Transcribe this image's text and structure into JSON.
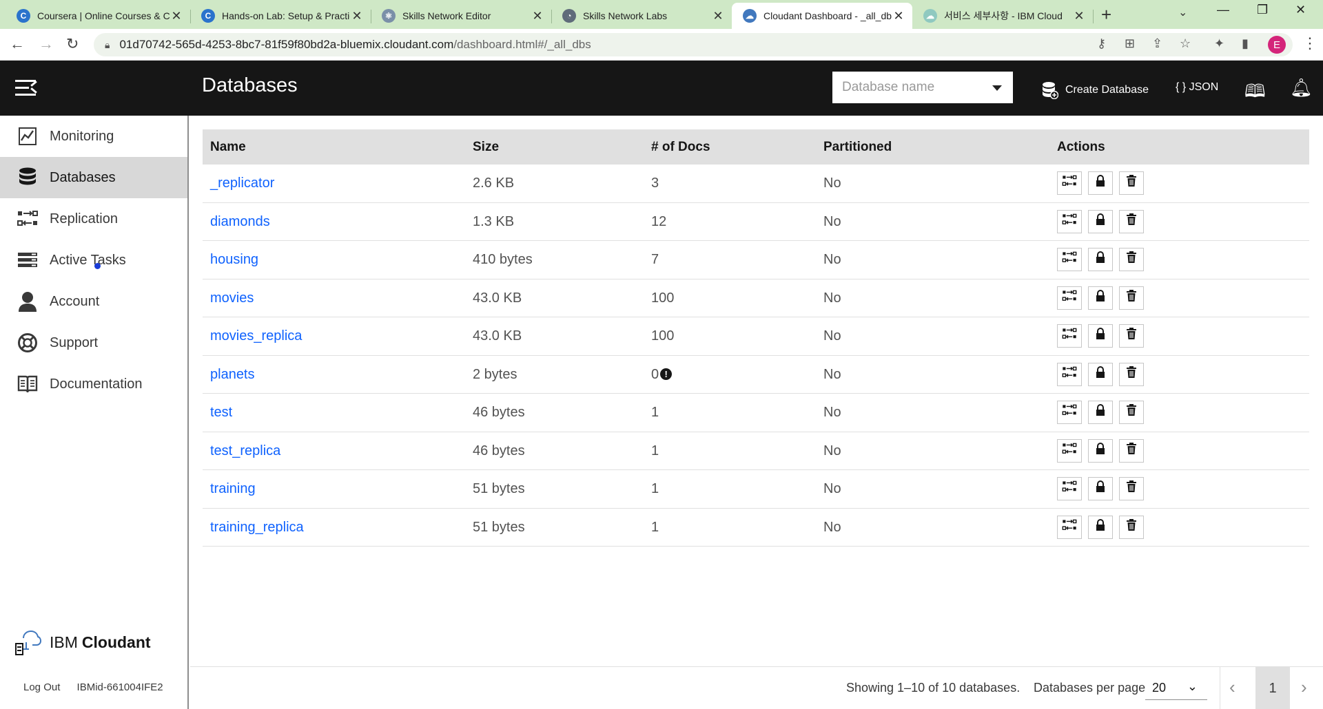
{
  "browser": {
    "tabs": [
      {
        "title": "Coursera | Online Courses & Credentials From Top Educators",
        "favicon": "C",
        "favicon_color": "#2a73cc"
      },
      {
        "title": "Hands-on Lab: Setup & Practice",
        "favicon": "C",
        "favicon_color": "#2a73cc"
      },
      {
        "title": "Skills Network Editor",
        "favicon": "⚛",
        "favicon_color": "#7a8fa8"
      },
      {
        "title": "Skills Network Labs",
        "favicon": "◔",
        "favicon_color": "#5f6b7a"
      },
      {
        "title": "Cloudant Dashboard - _all_dbs",
        "favicon": "☁",
        "favicon_color": "#4178be"
      },
      {
        "title": "서비스 세부사항 - IBM Cloud",
        "favicon": "☁",
        "favicon_color": "#8fc9c0"
      }
    ],
    "url_host": "01d70742-565d-4253-8bc7-81f59f80bd2a-bluemix.cloudant.com",
    "url_path": "/dashboard.html#/_all_dbs",
    "profile_initial": "E"
  },
  "header": {
    "title": "Databases",
    "search_placeholder": "Database name",
    "create_label": "Create Database",
    "json_label": "{ } JSON"
  },
  "sidebar": {
    "items": [
      {
        "label": "Monitoring",
        "icon": "chart-line-icon"
      },
      {
        "label": "Databases",
        "icon": "database-icon"
      },
      {
        "label": "Replication",
        "icon": "replicate-icon"
      },
      {
        "label": "Active Tasks",
        "icon": "tasks-icon"
      },
      {
        "label": "Account",
        "icon": "user-icon"
      },
      {
        "label": "Support",
        "icon": "lifebuoy-icon"
      },
      {
        "label": "Documentation",
        "icon": "book-icon"
      }
    ],
    "brand_1": "IBM",
    "brand_2": "Cloudant",
    "logout": "Log Out",
    "user_id": "IBMid-661004IFE2"
  },
  "table": {
    "headers": [
      "Name",
      "Size",
      "# of Docs",
      "Partitioned",
      "Actions"
    ],
    "rows": [
      {
        "name": "_replicator",
        "size": "2.6 KB",
        "docs": "3",
        "partitioned": "No"
      },
      {
        "name": "diamonds",
        "size": "1.3 KB",
        "docs": "12",
        "partitioned": "No"
      },
      {
        "name": "housing",
        "size": "410 bytes",
        "docs": "7",
        "partitioned": "No"
      },
      {
        "name": "movies",
        "size": "43.0 KB",
        "docs": "100",
        "partitioned": "No"
      },
      {
        "name": "movies_replica",
        "size": "43.0 KB",
        "docs": "100",
        "partitioned": "No"
      },
      {
        "name": "planets",
        "size": "2 bytes",
        "docs": "0",
        "partitioned": "No",
        "warning": true
      },
      {
        "name": "test",
        "size": "46 bytes",
        "docs": "1",
        "partitioned": "No"
      },
      {
        "name": "test_replica",
        "size": "46 bytes",
        "docs": "1",
        "partitioned": "No"
      },
      {
        "name": "training",
        "size": "51 bytes",
        "docs": "1",
        "partitioned": "No"
      },
      {
        "name": "training_replica",
        "size": "51 bytes",
        "docs": "1",
        "partitioned": "No"
      }
    ]
  },
  "pagination": {
    "showing": "Showing 1–10 of 10 databases.",
    "per_page_label": "Databases per page",
    "per_page_value": "20",
    "current_page": "1"
  },
  "colors": {
    "link": "#0f62fe",
    "header_bg": "#161616",
    "tabstrip_bg": "#cfe8c6"
  }
}
